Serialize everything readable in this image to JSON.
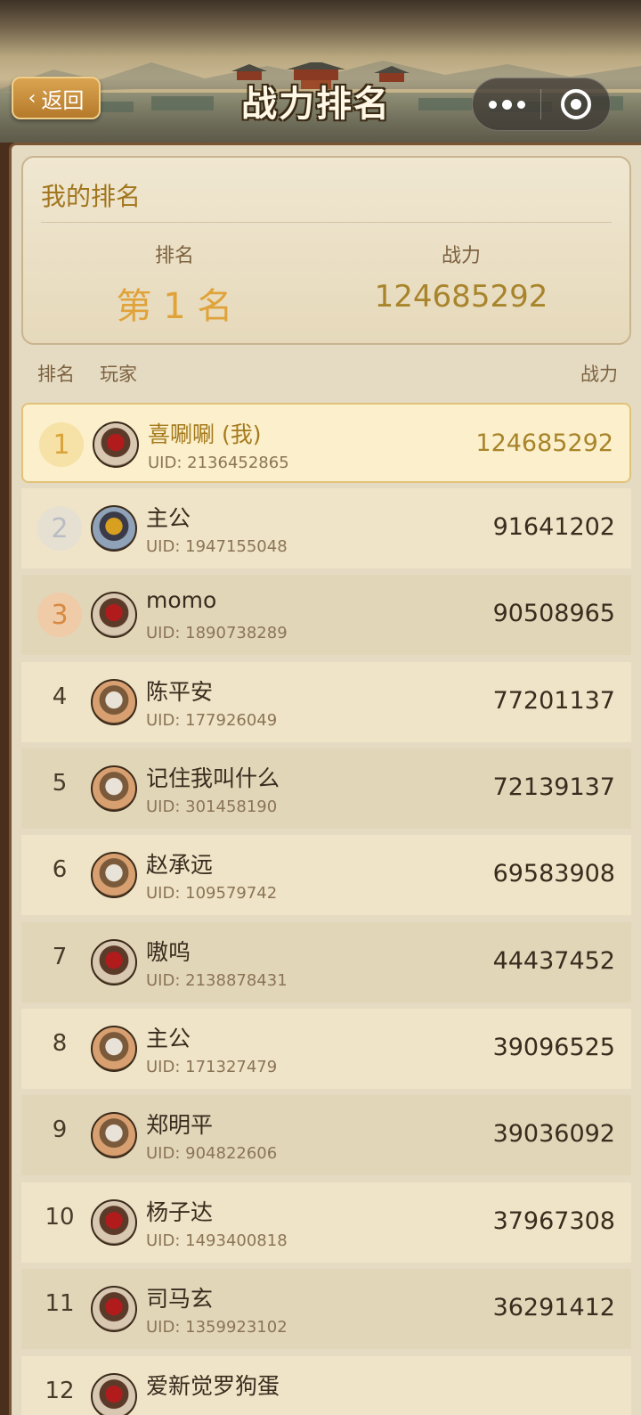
{
  "header": {
    "back_label": "返回",
    "title": "战力排名"
  },
  "my_rank": {
    "title": "我的排名",
    "rank_label": "排名",
    "rank_value": "第 1 名",
    "power_label": "战力",
    "power_value": "124685292"
  },
  "list_header": {
    "rank": "排名",
    "player": "玩家",
    "power": "战力"
  },
  "rows": [
    {
      "rank": "1",
      "name": "喜唰唰 (我)",
      "uid": "UID: 2136452865",
      "power": "124685292",
      "avatar": "red"
    },
    {
      "rank": "2",
      "name": "主公",
      "uid": "UID: 1947155048",
      "power": "91641202",
      "avatar": "gold"
    },
    {
      "rank": "3",
      "name": "momo",
      "uid": "UID: 1890738289",
      "power": "90508965",
      "avatar": "red"
    },
    {
      "rank": "4",
      "name": "陈平安",
      "uid": "UID: 177926049",
      "power": "77201137",
      "avatar": "white"
    },
    {
      "rank": "5",
      "name": "记住我叫什么",
      "uid": "UID: 301458190",
      "power": "72139137",
      "avatar": "white"
    },
    {
      "rank": "6",
      "name": "赵承远",
      "uid": "UID: 109579742",
      "power": "69583908",
      "avatar": "white"
    },
    {
      "rank": "7",
      "name": "嗷呜",
      "uid": "UID: 2138878431",
      "power": "44437452",
      "avatar": "red"
    },
    {
      "rank": "8",
      "name": "主公",
      "uid": "UID: 171327479",
      "power": "39096525",
      "avatar": "white"
    },
    {
      "rank": "9",
      "name": "郑明平",
      "uid": "UID: 904822606",
      "power": "39036092",
      "avatar": "white"
    },
    {
      "rank": "10",
      "name": "杨子达",
      "uid": "UID: 1493400818",
      "power": "37967308",
      "avatar": "red"
    },
    {
      "rank": "11",
      "name": "司马玄",
      "uid": "UID: 1359923102",
      "power": "36291412",
      "avatar": "red"
    },
    {
      "rank": "12",
      "name": "爱新觉罗狗蛋",
      "uid": "",
      "power": "",
      "avatar": "red"
    }
  ]
}
